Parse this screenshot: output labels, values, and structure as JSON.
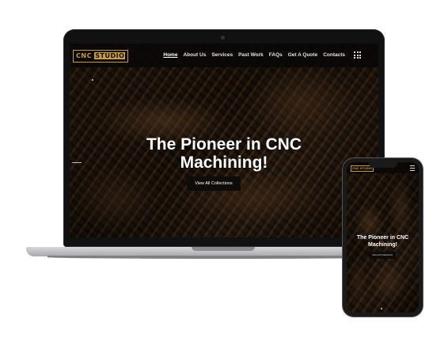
{
  "site": {
    "logo_left": "CNC",
    "logo_right": "STUDIO",
    "nav": [
      "Home",
      "About Us",
      "Services",
      "Past Work",
      "FAQs",
      "Get A Quote",
      "Contacts"
    ],
    "hero_title_line1": "The Pioneer in CNC",
    "hero_title_line2": "Machining!",
    "cta_label": "View All Collections"
  },
  "phone": {
    "logo": "CNC STUDIO",
    "hero_title_line1": "The Pioneer in CNC",
    "hero_title_line2": "Machining!",
    "cta_label": "View All Collections"
  },
  "colors": {
    "accent": "#c79a4c",
    "nav_bg": "#0a0806",
    "cta_bg": "#0e0b09"
  },
  "icons": {
    "menu": "grid-dots-icon",
    "phone_menu": "hamburger-icon"
  }
}
